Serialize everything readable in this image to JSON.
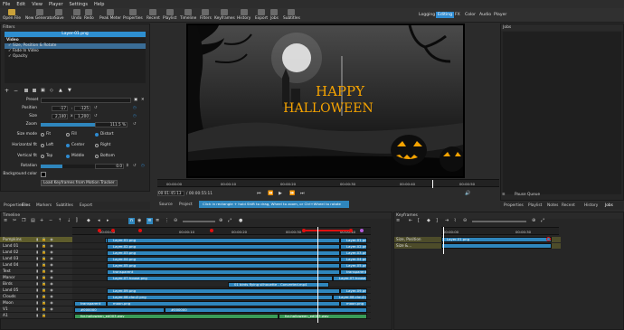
{
  "menu": [
    "File",
    "Edit",
    "View",
    "Player",
    "Settings",
    "Help"
  ],
  "toolbar": [
    {
      "label": "Open File",
      "icon": "folder-icon"
    },
    {
      "label": "New Generator",
      "icon": "generator-icon"
    },
    {
      "label": "Save",
      "icon": "save-icon"
    },
    {
      "label": "Undo",
      "icon": "undo-icon"
    },
    {
      "label": "Redo",
      "icon": "redo-icon"
    },
    {
      "label": "Peak Meter",
      "icon": "meter-icon"
    },
    {
      "label": "Properties",
      "icon": "properties-icon"
    },
    {
      "label": "Recent",
      "icon": "recent-icon"
    },
    {
      "label": "Playlist",
      "icon": "playlist-icon"
    },
    {
      "label": "Timeline",
      "icon": "timeline-icon"
    },
    {
      "label": "Filters",
      "icon": "filters-icon"
    },
    {
      "label": "Keyframes",
      "icon": "keyframes-icon"
    },
    {
      "label": "History",
      "icon": "history-icon"
    },
    {
      "label": "Export",
      "icon": "export-icon"
    },
    {
      "label": "Jobs",
      "icon": "jobs-icon"
    },
    {
      "label": "Subtitles",
      "icon": "subtitles-icon"
    }
  ],
  "modes": [
    "Logging",
    "Editing",
    "FX",
    "Color",
    "Audio",
    "Player"
  ],
  "active_mode": "Editing",
  "filters": {
    "title": "Filters",
    "clip_name": "Layer-01.png",
    "section": "Video",
    "items": [
      "Size, Position & Rotate",
      "Fade In Video",
      "Opacity"
    ],
    "preset_label": "Preset",
    "position_label": "Position",
    "position_x": "-17",
    "position_y": "-125",
    "size_label": "Size",
    "size_w": "2,140",
    "size_h": "1,200",
    "zoom_label": "Zoom",
    "zoom_value": "111.5 %",
    "size_mode_label": "Size mode",
    "size_modes": [
      "Fit",
      "Fill",
      "Distort"
    ],
    "h_fit_label": "Horizontal fit",
    "h_fits": [
      "Left",
      "Center",
      "Right"
    ],
    "v_fit_label": "Vertical fit",
    "v_fits": [
      "Top",
      "Middle",
      "Bottom"
    ],
    "rotation_label": "Rotation",
    "rotation_value": "0.0",
    "bg_label": "Background color",
    "load_keyframes": "Load Keyframes from Motion Tracker"
  },
  "jobs": {
    "title": "Jobs",
    "pause_queue": "Pause Queue"
  },
  "viewer": {
    "title_line1": "HAPPY",
    "title_line2": "HALLOWEEN",
    "ruler_ticks": [
      "00:00:00",
      "00:00:10",
      "00:00:20",
      "00:00:30",
      "00:00:40",
      "00:00:50"
    ],
    "position": "00:01:45:13",
    "duration": "/ 00:00:55:11",
    "tabs": [
      "Source",
      "Project"
    ],
    "hint": "Click in rectangle + hold Shift to drag, Wheel to zoom, or Ctrl+Wheel to rotate"
  },
  "left_tabs": [
    "Properties",
    "Files",
    "Markers",
    "Subtitles",
    "Export"
  ],
  "right_tabs": [
    "Properties",
    "Playlist",
    "Notes",
    "Recent",
    "History",
    "Jobs"
  ],
  "timeline": {
    "title": "Timeline",
    "ruler": [
      "00:00:00",
      "00:00:10",
      "00:00:20",
      "00:00:30",
      "00:00:40"
    ],
    "tracks": [
      "Pumpkins",
      "Land 01",
      "Land 02",
      "Land 03",
      "Land 04",
      "Text",
      "Manor",
      "Birds",
      "Land 05",
      "Clouds",
      "Moon",
      "V1",
      "A1"
    ],
    "clips": {
      "Pumpkins": [
        "Layer-01.png",
        "Layer-01.png"
      ],
      "Land 01": [
        "Layer-02.png",
        "Layer-02.png"
      ],
      "Land 02": [
        "Layer-03.png",
        "Layer-03.png"
      ],
      "Land 03": [
        "Layer-04.png",
        "Layer-04.png"
      ],
      "Land 04": [
        "Layer-05.png",
        "Layer-05.png"
      ],
      "Text": [
        "transparent",
        "transparent"
      ],
      "Manor": [
        "Layer-07-house.png",
        "Layer-07-house.png"
      ],
      "Birds": [
        "01 birds flying silhouette - Converted.mp4"
      ],
      "Land 05": [
        "Layer-09.png",
        "Layer-09.png"
      ],
      "Clouds": [
        "Layer-08-clou2.png",
        "Layer-08-clou2.png"
      ],
      "Moon": [
        "transparent",
        "moon.png",
        "moon.png"
      ],
      "V1": [
        "#000000",
        "#000000"
      ],
      "A1": [
        "for-halloween_ed003.wav",
        "for-halloween_ed003.wav"
      ]
    }
  },
  "keyframes": {
    "title": "Keyframes",
    "ruler": [
      "00:00:00",
      "00:00:30"
    ],
    "rows": [
      "Size, Position",
      "Size &..."
    ],
    "clip": "Layer-01.png"
  }
}
